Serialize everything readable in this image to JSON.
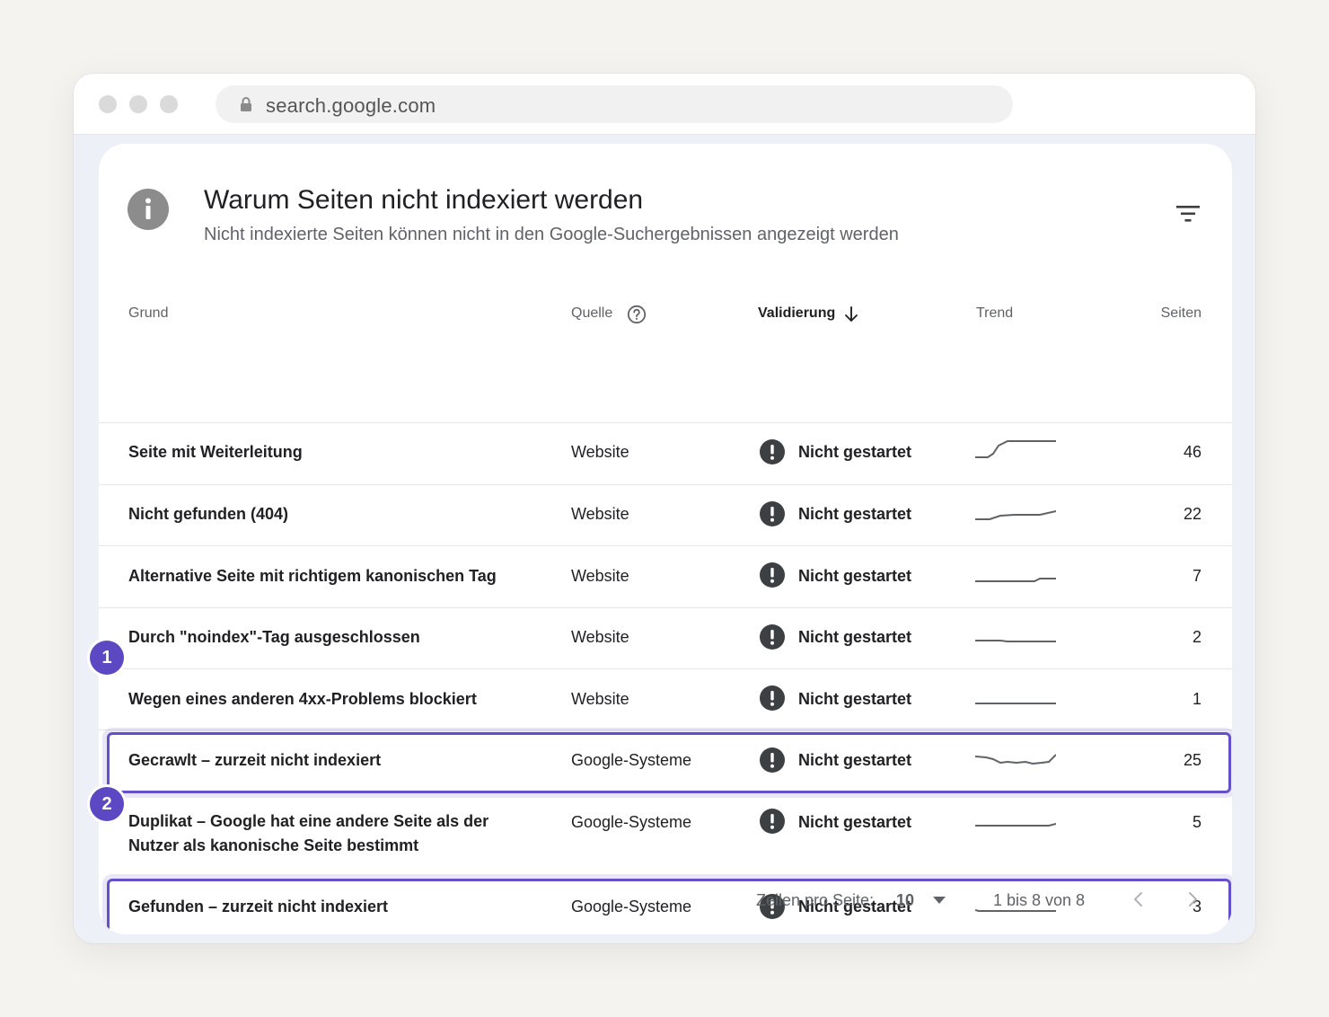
{
  "browser": {
    "url": "search.google.com"
  },
  "card": {
    "title": "Warum Seiten nicht indexiert werden",
    "subtitle": "Nicht indexierte Seiten können nicht in den Google-Suchergebnissen angezeigt werden"
  },
  "table": {
    "headers": {
      "reason": "Grund",
      "source": "Quelle",
      "validation": "Validierung",
      "trend": "Trend",
      "pages": "Seiten"
    },
    "rows": [
      {
        "reason": "Seite mit Weiterleitung",
        "source": "Website",
        "status": "Nicht gestartet",
        "pages": "46"
      },
      {
        "reason": "Nicht gefunden (404)",
        "source": "Website",
        "status": "Nicht gestartet",
        "pages": "22"
      },
      {
        "reason": "Alternative Seite mit richtigem kanonischen Tag",
        "source": "Website",
        "status": "Nicht gestartet",
        "pages": "7"
      },
      {
        "reason": "Durch \"noindex\"-Tag ausgeschlossen",
        "source": "Website",
        "status": "Nicht gestartet",
        "pages": "2"
      },
      {
        "reason": "Wegen eines anderen 4xx-Problems blockiert",
        "source": "Website",
        "status": "Nicht gestartet",
        "pages": "1"
      },
      {
        "reason": "Gecrawlt – zurzeit nicht indexiert",
        "source": "Google-Systeme",
        "status": "Nicht gestartet",
        "pages": "25"
      },
      {
        "reason": "Duplikat – Google hat eine andere Seite als der Nutzer als kanonische Seite bestimmt",
        "source": "Google-Systeme",
        "status": "Nicht gestartet",
        "pages": "5"
      },
      {
        "reason": "Gefunden – zurzeit nicht indexiert",
        "source": "Google-Systeme",
        "status": "Nicht gestartet",
        "pages": "3"
      }
    ]
  },
  "badges": [
    "1",
    "2"
  ],
  "pagination": {
    "rows_per_page_label": "Zeilen pro Seite:",
    "rows_per_page_value": "10",
    "range": "1 bis 8 von 8"
  },
  "colors": {
    "highlight": "#6650c9",
    "badge": "#5b48c2",
    "status_icon": "#3c4043"
  },
  "icons": {
    "lock": "lock-icon",
    "info": "info-icon",
    "filter": "filter-icon",
    "help": "help-circle-icon",
    "sort": "arrow-down-icon",
    "status": "exclamation-circle-icon",
    "prev": "chevron-left-icon",
    "next": "chevron-right-icon"
  }
}
